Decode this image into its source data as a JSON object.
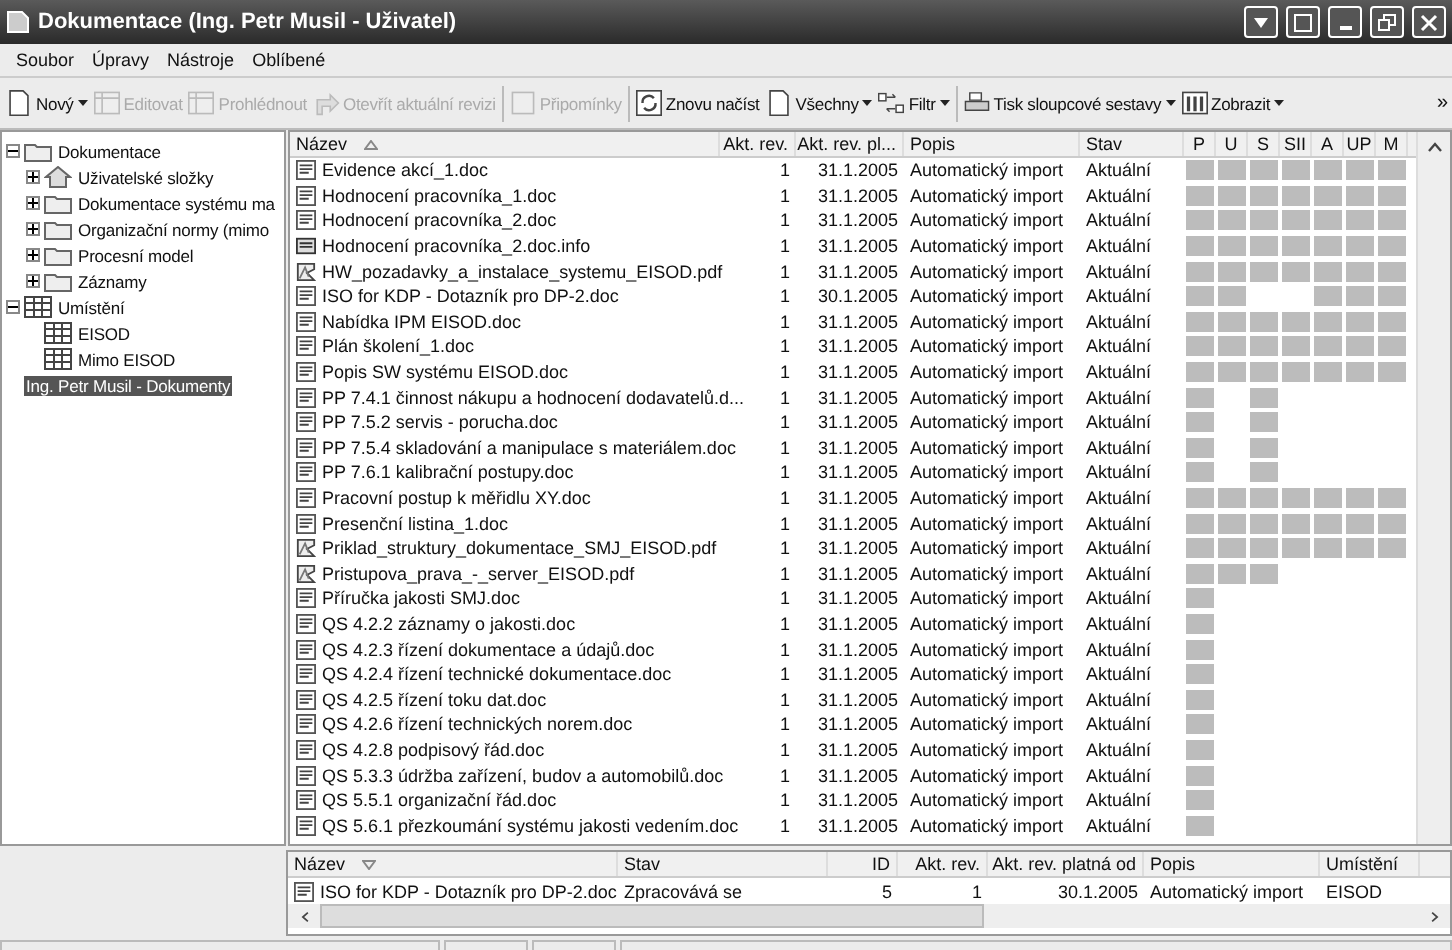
{
  "window": {
    "title": "Dokumentace (Ing. Petr Musil - Uživatel)"
  },
  "menu": [
    "Soubor",
    "Úpravy",
    "Nástroje",
    "Oblíbené"
  ],
  "toolbar": [
    {
      "label": "Nový",
      "kind": "new",
      "disabled": false,
      "menu": true
    },
    {
      "label": "Editovat",
      "kind": "edit",
      "disabled": true,
      "menu": false
    },
    {
      "label": "Prohlédnout",
      "kind": "view",
      "disabled": true,
      "menu": false
    },
    {
      "label": "Otevřít aktuální revizi",
      "kind": "open",
      "disabled": true,
      "menu": false
    },
    {
      "label": "Připomínky",
      "kind": "notes",
      "disabled": true,
      "menu": false
    },
    {
      "label": "Znovu načíst",
      "kind": "reload",
      "disabled": false,
      "menu": false
    },
    {
      "label": "Všechny",
      "kind": "new",
      "disabled": false,
      "menu": true
    },
    {
      "label": "Filtr",
      "kind": "filter",
      "disabled": false,
      "menu": true
    },
    {
      "label": "Tisk sloupcové sestavy",
      "kind": "print",
      "disabled": false,
      "menu": true
    },
    {
      "label": "Zobrazit",
      "kind": "columns",
      "disabled": false,
      "menu": true
    }
  ],
  "toolbar_overflow": "»",
  "tree": [
    {
      "label": "Dokumentace",
      "kind": "folder",
      "expanded": true,
      "selected": false,
      "children": [
        {
          "label": "Uživatelské složky",
          "kind": "home",
          "expanded": false,
          "selected": false
        },
        {
          "label": "Dokumentace systému ma",
          "kind": "folder",
          "expanded": false,
          "selected": false
        },
        {
          "label": "Organizační normy (mimo",
          "kind": "folder",
          "expanded": false,
          "selected": false
        },
        {
          "label": "Procesní model",
          "kind": "folder",
          "expanded": false,
          "selected": false
        },
        {
          "label": "Záznamy",
          "kind": "folder",
          "expanded": false,
          "selected": false
        }
      ]
    },
    {
      "label": "Umístění",
      "kind": "grid",
      "expanded": true,
      "selected": false,
      "children": [
        {
          "label": "EISOD",
          "kind": "grid",
          "selected": false
        },
        {
          "label": "Mimo EISOD",
          "kind": "grid",
          "selected": false
        }
      ]
    },
    {
      "label": "Ing. Petr Musil - Dokumenty",
      "kind": "none",
      "selected": true
    }
  ],
  "list": {
    "columns": [
      "Název",
      "Akt. rev.",
      "Akt. rev. pl...",
      "Popis",
      "Stav"
    ],
    "perm_columns": [
      "P",
      "U",
      "S",
      "SII",
      "A",
      "UP",
      "M"
    ],
    "rows": [
      {
        "name": "Evidence akcí_1.doc",
        "kind": "doc",
        "rev": "1",
        "date": "31.1.2005",
        "desc": "Automatický import",
        "status": "Aktuální",
        "perms": [
          true,
          true,
          true,
          true,
          true,
          true,
          true
        ]
      },
      {
        "name": "Hodnocení pracovníka_1.doc",
        "kind": "doc",
        "rev": "1",
        "date": "31.1.2005",
        "desc": "Automatický import",
        "status": "Aktuální",
        "perms": [
          true,
          true,
          true,
          true,
          true,
          true,
          true
        ]
      },
      {
        "name": "Hodnocení pracovníka_2.doc",
        "kind": "doc",
        "rev": "1",
        "date": "31.1.2005",
        "desc": "Automatický import",
        "status": "Aktuální",
        "perms": [
          true,
          true,
          true,
          true,
          true,
          true,
          true
        ]
      },
      {
        "name": "Hodnocení pracovníka_2.doc.info",
        "kind": "info",
        "rev": "1",
        "date": "31.1.2005",
        "desc": "Automatický import",
        "status": "Aktuální",
        "perms": [
          true,
          true,
          true,
          true,
          true,
          true,
          true
        ]
      },
      {
        "name": "HW_pozadavky_a_instalace_systemu_EISOD.pdf",
        "kind": "pdf",
        "rev": "1",
        "date": "31.1.2005",
        "desc": "Automatický import",
        "status": "Aktuální",
        "perms": [
          true,
          true,
          true,
          true,
          true,
          true,
          true
        ]
      },
      {
        "name": "ISO for KDP - Dotazník pro DP-2.doc",
        "kind": "doc",
        "rev": "1",
        "date": "30.1.2005",
        "desc": "Automatický import",
        "status": "Aktuální",
        "perms": [
          true,
          true,
          false,
          false,
          true,
          true,
          true
        ]
      },
      {
        "name": "Nabídka IPM EISOD.doc",
        "kind": "doc",
        "rev": "1",
        "date": "31.1.2005",
        "desc": "Automatický import",
        "status": "Aktuální",
        "perms": [
          true,
          true,
          true,
          true,
          true,
          true,
          true
        ]
      },
      {
        "name": "Plán školení_1.doc",
        "kind": "doc",
        "rev": "1",
        "date": "31.1.2005",
        "desc": "Automatický import",
        "status": "Aktuální",
        "perms": [
          true,
          true,
          true,
          true,
          true,
          true,
          true
        ]
      },
      {
        "name": "Popis SW systému EISOD.doc",
        "kind": "doc",
        "rev": "1",
        "date": "31.1.2005",
        "desc": "Automatický import",
        "status": "Aktuální",
        "perms": [
          true,
          true,
          true,
          true,
          true,
          true,
          true
        ]
      },
      {
        "name": "PP 7.4.1 činnost nákupu a hodnocení dodavatelů.d...",
        "kind": "doc",
        "rev": "1",
        "date": "31.1.2005",
        "desc": "Automatický import",
        "status": "Aktuální",
        "perms": [
          true,
          false,
          true,
          false,
          false,
          false,
          false
        ]
      },
      {
        "name": "PP 7.5.2 servis - porucha.doc",
        "kind": "doc",
        "rev": "1",
        "date": "31.1.2005",
        "desc": "Automatický import",
        "status": "Aktuální",
        "perms": [
          true,
          false,
          true,
          false,
          false,
          false,
          false
        ]
      },
      {
        "name": "PP 7.5.4 skladování a manipulace s materiálem.doc",
        "kind": "doc",
        "rev": "1",
        "date": "31.1.2005",
        "desc": "Automatický import",
        "status": "Aktuální",
        "perms": [
          true,
          false,
          true,
          false,
          false,
          false,
          false
        ]
      },
      {
        "name": "PP 7.6.1 kalibrační postupy.doc",
        "kind": "doc",
        "rev": "1",
        "date": "31.1.2005",
        "desc": "Automatický import",
        "status": "Aktuální",
        "perms": [
          true,
          false,
          true,
          false,
          false,
          false,
          false
        ]
      },
      {
        "name": "Pracovní postup k měřidlu XY.doc",
        "kind": "doc",
        "rev": "1",
        "date": "31.1.2005",
        "desc": "Automatický import",
        "status": "Aktuální",
        "perms": [
          true,
          true,
          true,
          true,
          true,
          true,
          true
        ]
      },
      {
        "name": "Presenční listina_1.doc",
        "kind": "doc",
        "rev": "1",
        "date": "31.1.2005",
        "desc": "Automatický import",
        "status": "Aktuální",
        "perms": [
          true,
          true,
          true,
          true,
          true,
          true,
          true
        ]
      },
      {
        "name": "Priklad_struktury_dokumentace_SMJ_EISOD.pdf",
        "kind": "pdf",
        "rev": "1",
        "date": "31.1.2005",
        "desc": "Automatický import",
        "status": "Aktuální",
        "perms": [
          true,
          true,
          true,
          true,
          true,
          true,
          true
        ]
      },
      {
        "name": "Pristupova_prava_-_server_EISOD.pdf",
        "kind": "pdf",
        "rev": "1",
        "date": "31.1.2005",
        "desc": "Automatický import",
        "status": "Aktuální",
        "perms": [
          true,
          true,
          true,
          false,
          false,
          false,
          false
        ]
      },
      {
        "name": "Příručka jakosti SMJ.doc",
        "kind": "doc",
        "rev": "1",
        "date": "31.1.2005",
        "desc": "Automatický import",
        "status": "Aktuální",
        "perms": [
          true,
          false,
          false,
          false,
          false,
          false,
          false
        ]
      },
      {
        "name": "QS 4.2.2 záznamy o jakosti.doc",
        "kind": "doc",
        "rev": "1",
        "date": "31.1.2005",
        "desc": "Automatický import",
        "status": "Aktuální",
        "perms": [
          true,
          false,
          false,
          false,
          false,
          false,
          false
        ]
      },
      {
        "name": "QS 4.2.3 řízení dokumentace a údajů.doc",
        "kind": "doc",
        "rev": "1",
        "date": "31.1.2005",
        "desc": "Automatický import",
        "status": "Aktuální",
        "perms": [
          true,
          false,
          false,
          false,
          false,
          false,
          false
        ]
      },
      {
        "name": "QS 4.2.4 řízení technické dokumentace.doc",
        "kind": "doc",
        "rev": "1",
        "date": "31.1.2005",
        "desc": "Automatický import",
        "status": "Aktuální",
        "perms": [
          true,
          false,
          false,
          false,
          false,
          false,
          false
        ]
      },
      {
        "name": "QS 4.2.5 řízení toku dat.doc",
        "kind": "doc",
        "rev": "1",
        "date": "31.1.2005",
        "desc": "Automatický import",
        "status": "Aktuální",
        "perms": [
          true,
          false,
          false,
          false,
          false,
          false,
          false
        ]
      },
      {
        "name": "QS 4.2.6 řízení technických norem.doc",
        "kind": "doc",
        "rev": "1",
        "date": "31.1.2005",
        "desc": "Automatický import",
        "status": "Aktuální",
        "perms": [
          true,
          false,
          false,
          false,
          false,
          false,
          false
        ]
      },
      {
        "name": "QS 4.2.8 podpisový řád.doc",
        "kind": "doc",
        "rev": "1",
        "date": "31.1.2005",
        "desc": "Automatický import",
        "status": "Aktuální",
        "perms": [
          true,
          false,
          false,
          false,
          false,
          false,
          false
        ]
      },
      {
        "name": "QS 5.3.3 údržba zařízení, budov a automobilů.doc",
        "kind": "doc",
        "rev": "1",
        "date": "31.1.2005",
        "desc": "Automatický import",
        "status": "Aktuální",
        "perms": [
          true,
          false,
          false,
          false,
          false,
          false,
          false
        ]
      },
      {
        "name": "QS 5.5.1 organizační řád.doc",
        "kind": "doc",
        "rev": "1",
        "date": "31.1.2005",
        "desc": "Automatický import",
        "status": "Aktuální",
        "perms": [
          true,
          false,
          false,
          false,
          false,
          false,
          false
        ]
      },
      {
        "name": "QS 5.6.1 přezkoumání systému jakosti vedením.doc",
        "kind": "doc",
        "rev": "1",
        "date": "31.1.2005",
        "desc": "Automatický import",
        "status": "Aktuální",
        "perms": [
          true,
          false,
          false,
          false,
          false,
          false,
          false
        ]
      }
    ]
  },
  "detail": {
    "columns": [
      "Název",
      "Stav",
      "ID",
      "Akt. rev.",
      "Akt. rev. platná od",
      "Popis",
      "Umístění"
    ],
    "rows": [
      {
        "kind": "doc",
        "cells": [
          "ISO for KDP - Dotazník pro DP-2.doc",
          "Zpracovává se",
          "5",
          "1",
          "30.1.2005",
          "Automatický import",
          "EISOD"
        ]
      }
    ]
  }
}
